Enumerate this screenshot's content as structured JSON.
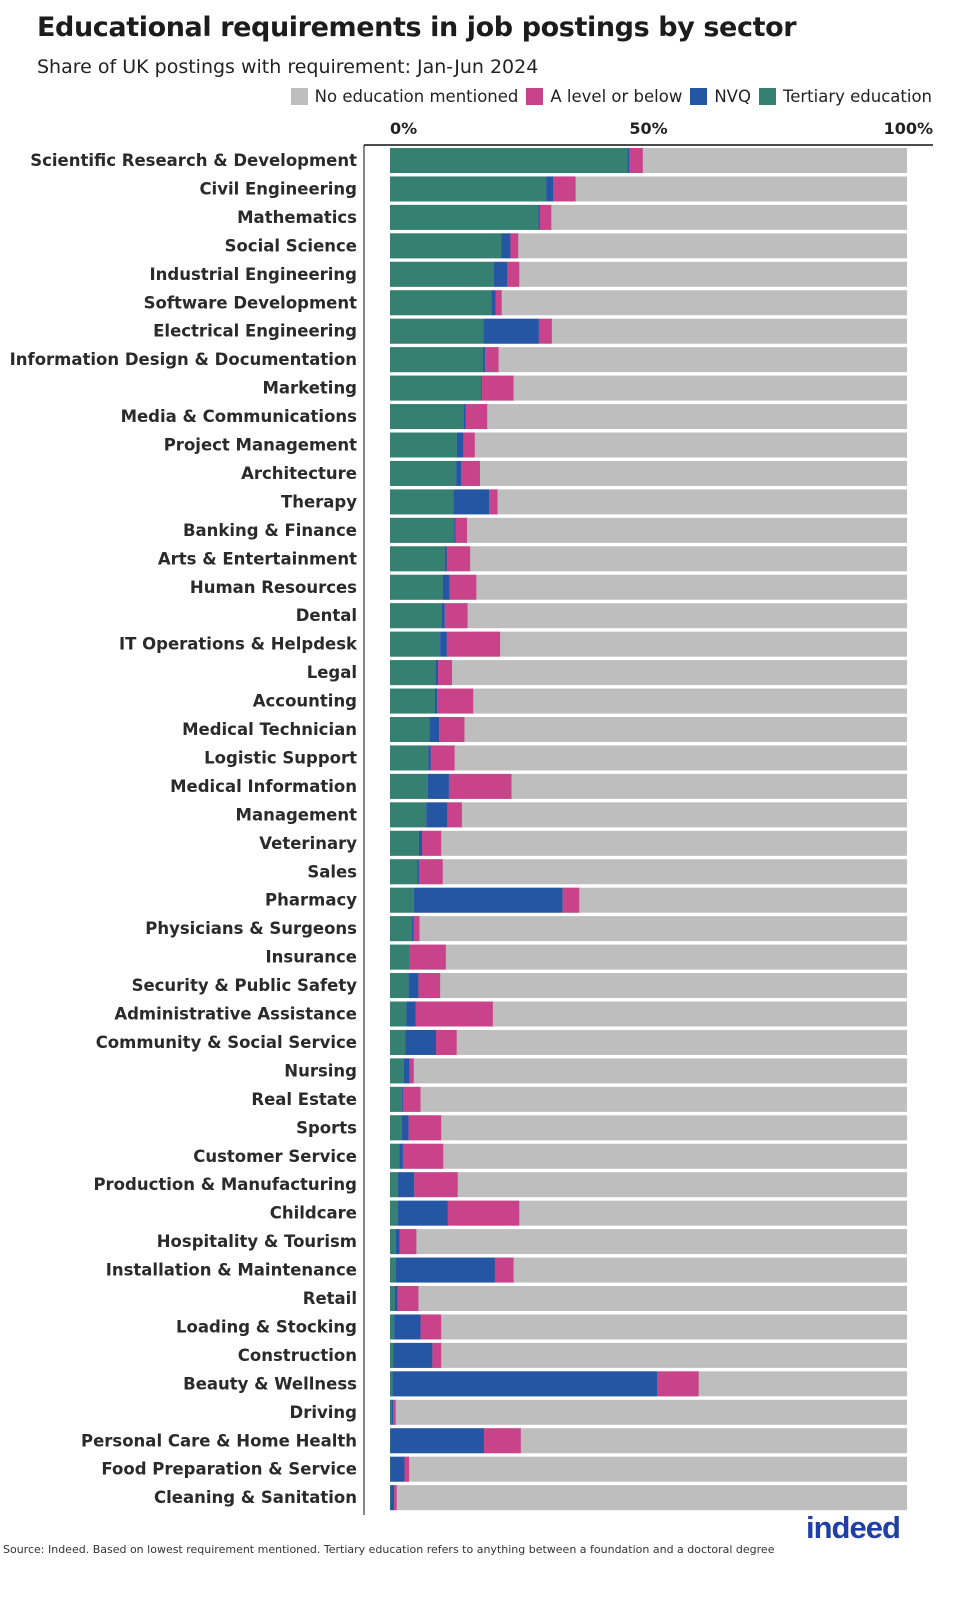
{
  "header": {
    "title": "Educational requirements in job postings by sector",
    "subtitle": "Share of UK postings with requirement: Jan-Jun 2024"
  },
  "legend": [
    {
      "label": "No education mentioned",
      "color": "#bebebe"
    },
    {
      "label": "A level or below",
      "color": "#c8438a"
    },
    {
      "label": "NVQ",
      "color": "#2456a4"
    },
    {
      "label": "Tertiary education",
      "color": "#358070"
    }
  ],
  "footer": {
    "source": "Source: Indeed. Based on lowest requirement mentioned. Tertiary education refers to anything between a foundation and a doctoral degree",
    "logo": "indeed"
  },
  "chart_data": {
    "type": "bar",
    "orientation": "horizontal",
    "stacked": true,
    "title": "Educational requirements in job postings by sector",
    "subtitle": "Share of UK postings with requirement: Jan-Jun 2024",
    "xlabel": "",
    "ylabel": "",
    "xlim": [
      0,
      100
    ],
    "x_ticks": [
      "0%",
      "50%",
      "100%"
    ],
    "x_tick_values": [
      0,
      50,
      100
    ],
    "legend_position": "top-right",
    "categories": [
      "Scientific Research & Development",
      "Civil Engineering",
      "Mathematics",
      "Social Science",
      "Industrial Engineering",
      "Software Development",
      "Electrical Engineering",
      "Information Design & Documentation",
      "Marketing",
      "Media & Communications",
      "Project Management",
      "Architecture",
      "Therapy",
      "Banking & Finance",
      "Arts & Entertainment",
      "Human Resources",
      "Dental",
      "IT Operations & Helpdesk",
      "Legal",
      "Accounting",
      "Medical Technician",
      "Logistic Support",
      "Medical Information",
      "Management",
      "Veterinary",
      "Sales",
      "Pharmacy",
      "Physicians & Surgeons",
      "Insurance",
      "Security & Public Safety",
      "Administrative Assistance",
      "Community & Social Service",
      "Nursing",
      "Real Estate",
      "Sports",
      "Customer Service",
      "Production & Manufacturing",
      "Childcare",
      "Hospitality & Tourism",
      "Installation & Maintenance",
      "Retail",
      "Loading & Stocking",
      "Construction",
      "Beauty & Wellness",
      "Driving",
      "Personal Care & Home Health",
      "Food Preparation & Service",
      "Cleaning & Sanitation"
    ],
    "series": [
      {
        "name": "Tertiary education",
        "color": "#358070",
        "values": [
          45.9,
          30.2,
          28.7,
          21.5,
          20.1,
          19.6,
          18.1,
          18.0,
          17.7,
          14.3,
          12.9,
          12.8,
          12.3,
          12.4,
          10.6,
          10.2,
          10.0,
          9.7,
          8.9,
          8.7,
          7.6,
          7.4,
          7.3,
          7.0,
          5.6,
          5.3,
          4.6,
          4.2,
          3.7,
          3.6,
          3.2,
          3.0,
          2.7,
          2.3,
          2.3,
          1.8,
          1.5,
          1.5,
          1.1,
          1.1,
          0.9,
          0.8,
          0.6,
          0.5,
          0.3,
          0.1,
          0.1,
          0.1
        ]
      },
      {
        "name": "NVQ",
        "color": "#2456a4",
        "values": [
          0.4,
          1.4,
          0.3,
          1.8,
          2.6,
          0.8,
          10.7,
          0.4,
          0.1,
          0.3,
          1.3,
          1.0,
          6.9,
          0.3,
          0.4,
          1.3,
          0.6,
          1.3,
          0.4,
          0.4,
          1.9,
          0.5,
          4.1,
          4.1,
          0.6,
          0.3,
          28.8,
          0.4,
          0.1,
          1.9,
          1.8,
          5.9,
          1.1,
          0.2,
          1.3,
          0.7,
          3.2,
          9.7,
          0.8,
          19.2,
          0.6,
          5.1,
          7.6,
          51.2,
          0.3,
          18.1,
          2.7,
          0.7
        ]
      },
      {
        "name": "A level or below",
        "color": "#c8438a",
        "values": [
          2.6,
          4.3,
          2.2,
          1.5,
          2.3,
          1.2,
          2.5,
          2.6,
          6.1,
          4.2,
          2.2,
          3.6,
          1.6,
          2.2,
          4.5,
          5.2,
          4.4,
          10.3,
          2.7,
          7.0,
          4.9,
          4.6,
          12.1,
          2.8,
          3.7,
          4.6,
          3.2,
          1.1,
          7.0,
          4.2,
          14.9,
          4.0,
          0.8,
          3.4,
          6.3,
          7.8,
          8.4,
          13.8,
          3.2,
          3.6,
          4.0,
          4.0,
          1.7,
          8.0,
          0.5,
          7.1,
          0.9,
          0.5
        ]
      },
      {
        "name": "No education mentioned",
        "color": "#bebebe",
        "values": "remainder to 100%"
      }
    ]
  }
}
